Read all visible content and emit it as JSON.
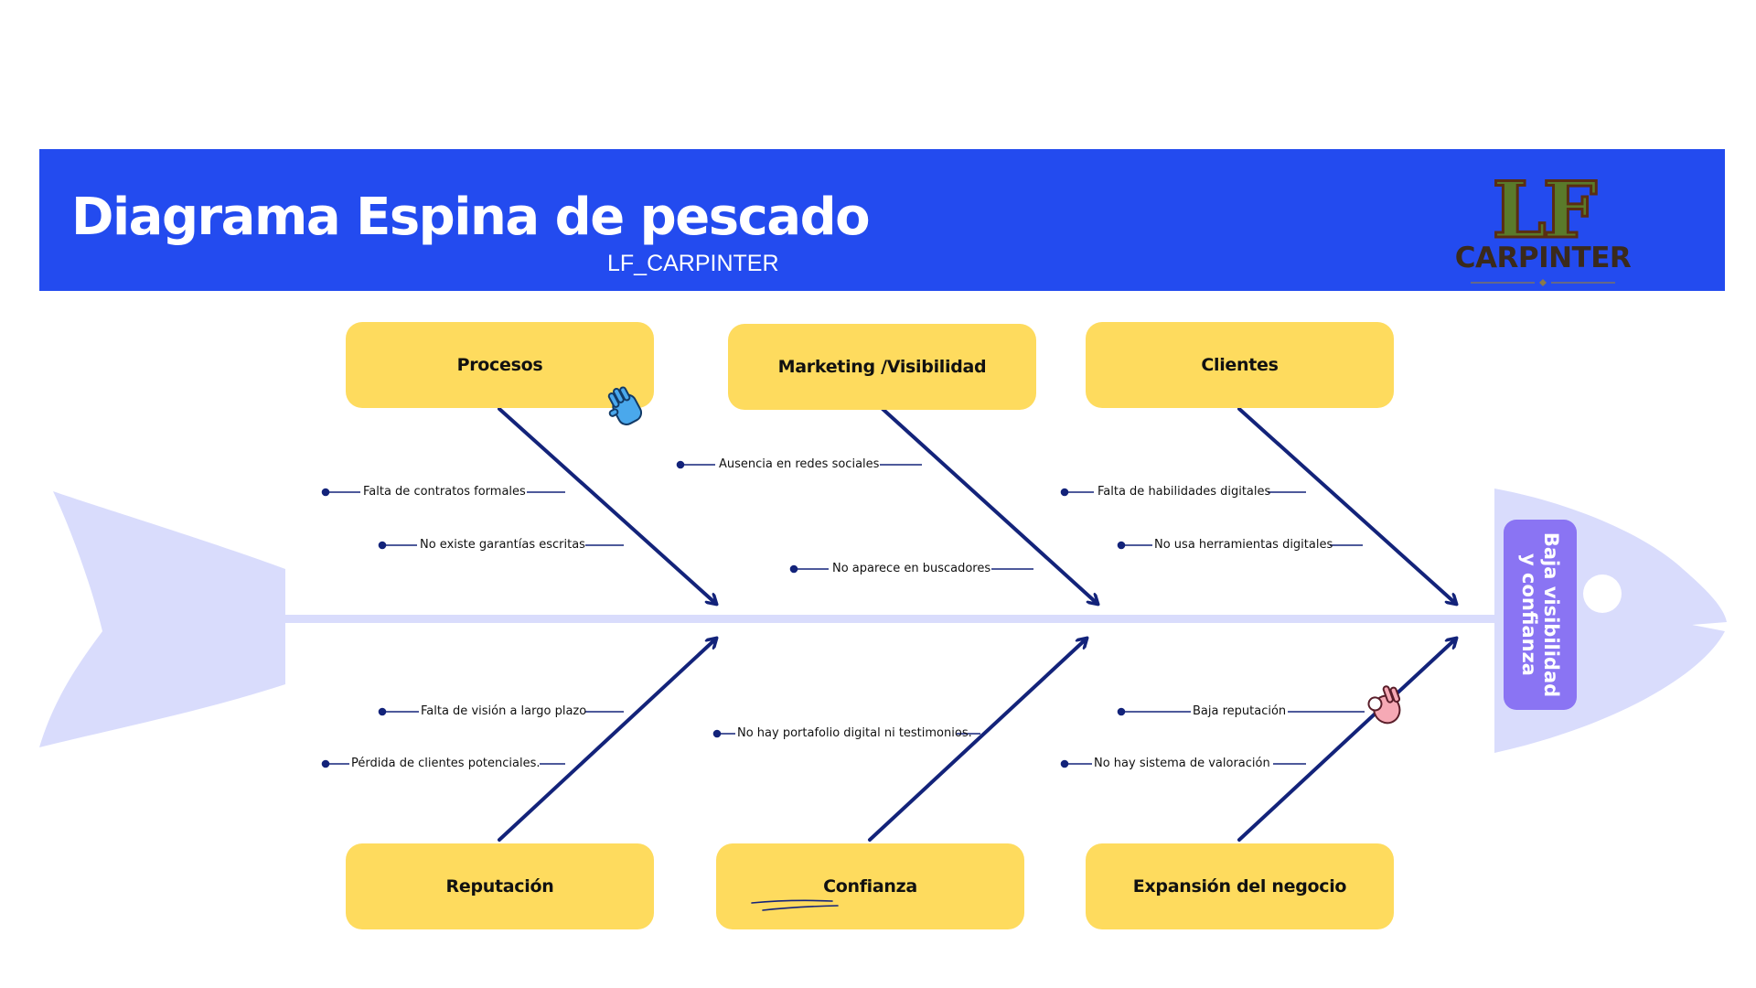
{
  "header": {
    "title": "Diagrama Espina de pescado",
    "subtitle": "LF_CARPINTER",
    "background_color": "#234bef"
  },
  "logo": {
    "letters": "LF",
    "word": "CARPINTER"
  },
  "effect": {
    "label": "Baja visibilidad y confianza",
    "color": "#8a74f3"
  },
  "categories": {
    "top": [
      "Procesos",
      "Marketing /Visibilidad",
      "Clientes"
    ],
    "bottom": [
      "Reputación",
      "Confianza",
      "Expansión del negocio"
    ]
  },
  "causes": {
    "procesos": [
      "Falta de contratos formales",
      "No existe garantías escritas"
    ],
    "marketing": [
      "Ausencia en redes sociales",
      "No aparece en buscadores"
    ],
    "clientes": [
      "Falta de habilidades digitales",
      "No usa herramientas digitales"
    ],
    "reputacion": [
      "Falta de visión a largo plazo",
      "Pérdida de clientes potenciales."
    ],
    "confianza": [
      "No hay portafolio digital ni testimonios."
    ],
    "expansion": [
      "Baja reputación",
      "No hay sistema de valoración"
    ]
  },
  "colors": {
    "category_box": "#fedb5e",
    "fish_body": "#d9dcfc",
    "bones": "#13237a"
  },
  "icons": [
    "clapping-hands-icon",
    "ok-hand-icon"
  ]
}
